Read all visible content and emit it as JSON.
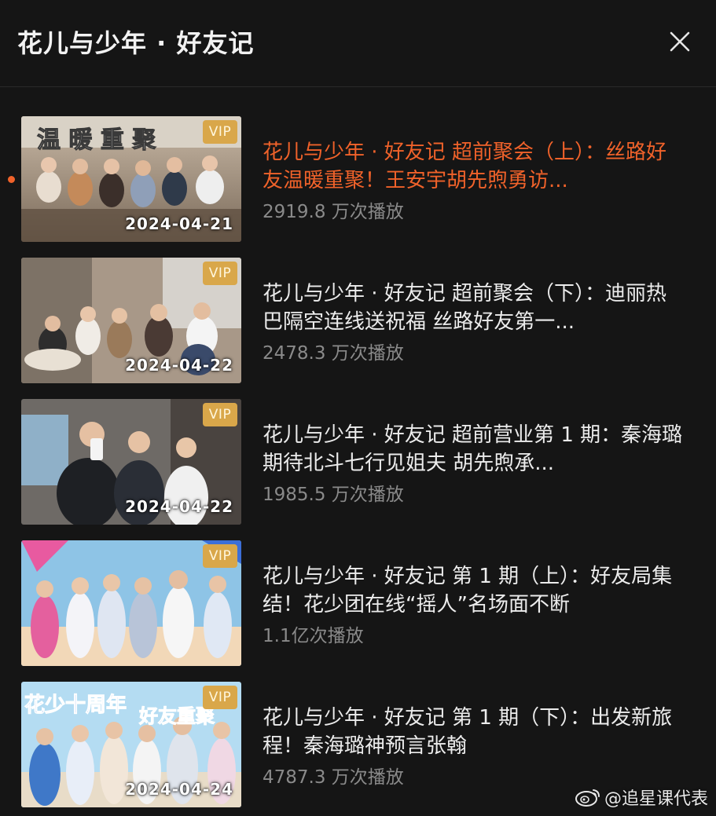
{
  "header": {
    "title": "花儿与少年 · 好友记",
    "close_icon": "close-icon"
  },
  "colors": {
    "background": "#151515",
    "active_title": "#f0622a",
    "vip_badge": "#d9a74a",
    "views_text": "#8a8a8a"
  },
  "episodes": [
    {
      "title": "花儿与少年 · 好友记 超前聚会（上）：丝路好友温暖重聚！王安宇胡先煦勇访...",
      "views": "2919.8 万次播放",
      "date": "2024-04-21",
      "badge": "VIP",
      "thumb_text": "温暖重聚",
      "playing": true
    },
    {
      "title": "花儿与少年 · 好友记 超前聚会（下）：迪丽热巴隔空连线送祝福 丝路好友第一...",
      "views": "2478.3 万次播放",
      "date": "2024-04-22",
      "badge": "VIP",
      "playing": false
    },
    {
      "title": "花儿与少年 · 好友记 超前营业第 1 期：秦海璐期待北斗七行见姐夫 胡先煦承...",
      "views": "1985.5 万次播放",
      "date": "2024-04-22",
      "badge": "VIP",
      "playing": false
    },
    {
      "title": "花儿与少年 · 好友记 第 1 期（上）：好友局集结！花少团在线“摇人”名场面不断",
      "views": "1.1亿次播放",
      "date": "",
      "badge": "VIP",
      "playing": false
    },
    {
      "title": "花儿与少年 · 好友记 第 1 期（下）：出发新旅程！秦海璐神预言张翰",
      "views": "4787.3 万次播放",
      "date": "2024-04-24",
      "badge": "VIP",
      "thumb_text": "花少十周年 好友重聚",
      "playing": false
    }
  ],
  "watermark": {
    "text": "@追星课代表",
    "icon": "weibo-icon"
  }
}
